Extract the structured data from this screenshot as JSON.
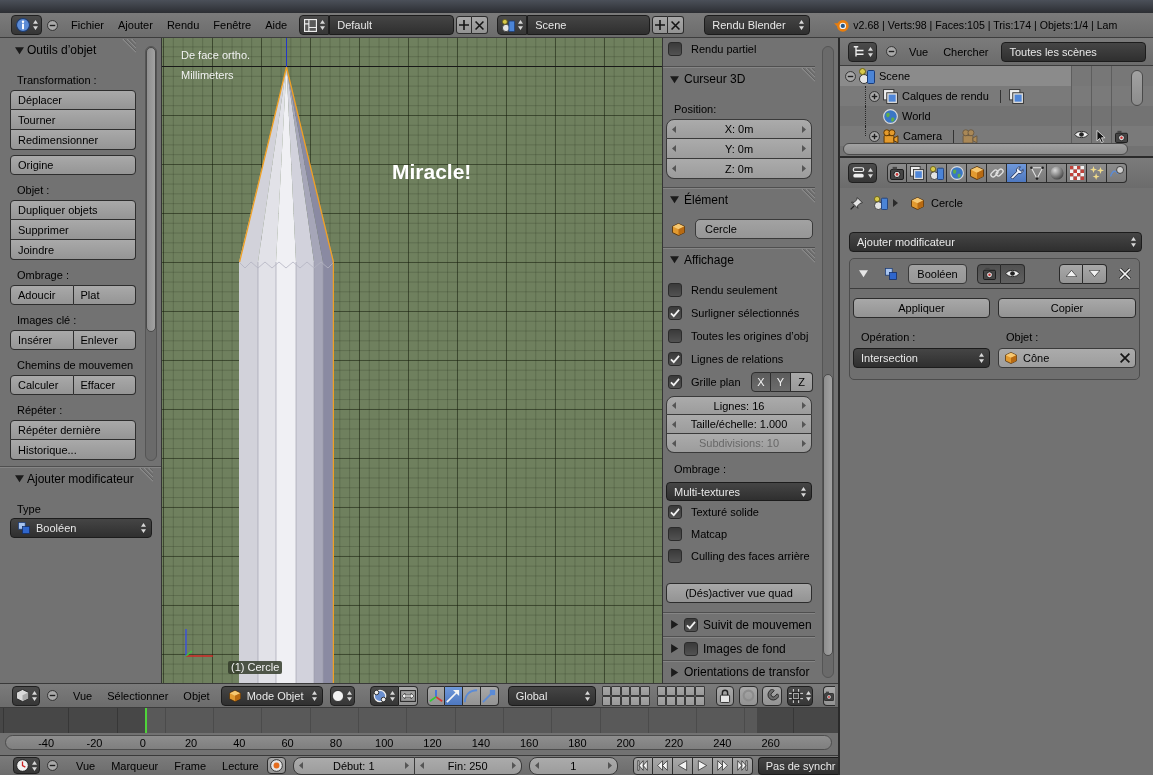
{
  "info_header": {
    "menus": [
      "Fichier",
      "Ajouter",
      "Rendu",
      "Fenêtre",
      "Aide"
    ],
    "screen_layout": "Default",
    "scene": "Scene",
    "render_engine": "Rendu Blender",
    "stats": "v2.68 | Verts:98 | Faces:105 | Tris:174 | Objets:1/4 | Lam"
  },
  "tool_shelf": {
    "object_tools": {
      "title": "Outils d’objet",
      "expanded": true,
      "groups": [
        {
          "label": "Transformation :",
          "kind": "column",
          "buttons": [
            "Déplacer",
            "Tourner",
            "Redimensionner"
          ]
        },
        {
          "kind": "column",
          "buttons": [
            "Origine"
          ]
        },
        {
          "label": "Objet :",
          "kind": "column",
          "buttons": [
            "Dupliquer objets",
            "Supprimer",
            "Joindre"
          ]
        },
        {
          "label": "Ombrage :",
          "kind": "row",
          "buttons": [
            "Adoucir",
            "Plat"
          ]
        },
        {
          "label": "Images clé :",
          "kind": "row",
          "buttons": [
            "Insérer",
            "Enlever"
          ]
        },
        {
          "label": "Chemins de mouvemen",
          "kind": "row",
          "buttons": [
            "Calculer",
            "Effacer"
          ]
        },
        {
          "label": "Répéter :",
          "kind": "column",
          "buttons": [
            "Répéter dernière",
            "Historique..."
          ]
        }
      ]
    },
    "add_modifier": {
      "title": "Ajouter modificateur",
      "expanded": true,
      "type_label": "Type",
      "type_value": "Booléen"
    }
  },
  "viewport": {
    "view_name": "De face ortho.",
    "units": "Millimeters",
    "annotation": "Miracle!",
    "object_label": "(1) Cercle"
  },
  "view_panel": {
    "partial_render": {
      "label": "Rendu partiel",
      "checked": false
    },
    "cursor": {
      "title": "Curseur 3D",
      "expanded": true,
      "position_label": "Position:",
      "fields": [
        "X: 0m",
        "Y: 0m",
        "Z: 0m"
      ]
    },
    "item": {
      "title": "Élément",
      "expanded": true,
      "name": "Cercle"
    },
    "display": {
      "title": "Affichage",
      "expanded": true,
      "options": [
        {
          "label": "Rendu seulement",
          "checked": false
        },
        {
          "label": "Surligner sélectionnés",
          "checked": true
        },
        {
          "label": "Toutes les origines d’obj",
          "checked": false
        },
        {
          "label": "Lignes de relations",
          "checked": true
        }
      ],
      "grid_floor": {
        "label": "Grille plan",
        "checked": true,
        "axes": [
          {
            "label": "X",
            "on": true
          },
          {
            "label": "Y",
            "on": true
          },
          {
            "label": "Z",
            "on": false
          }
        ]
      },
      "grid_fields": [
        {
          "label": "Lignes: 16",
          "disabled": false
        },
        {
          "label": "Taille/échelle: 1.000",
          "disabled": false
        },
        {
          "label": "Subdivisions: 10",
          "disabled": true
        }
      ],
      "shading_label": "Ombrage :",
      "shading_mode": "Multi-textures",
      "shading_options": [
        {
          "label": "Texturé solide",
          "checked": true
        },
        {
          "label": "Matcap",
          "checked": false
        },
        {
          "label": "Culling des faces arrière",
          "checked": false
        }
      ],
      "quad_view_button": "(Dés)activer vue quad"
    },
    "collapsed_panels": [
      {
        "title": "Suivit de mouvemen",
        "expanded": false,
        "kind": "checkbox",
        "checked": true
      },
      {
        "title": "Images de fond",
        "expanded": false,
        "kind": "checkbox",
        "checked": false
      },
      {
        "title": "Orientations de transfor",
        "expanded": false,
        "kind": "plain"
      }
    ]
  },
  "outliner": {
    "menus": [
      "Vue",
      "Chercher"
    ],
    "filter": "Toutes les scènes",
    "tree": [
      {
        "label": "Scene",
        "kind": "scene",
        "expanded": true,
        "selected": true,
        "children": [
          {
            "label": "Calques de rendu",
            "kind": "render_layers",
            "expanded": false,
            "selected": false
          },
          {
            "label": "World",
            "kind": "world",
            "selected": false
          },
          {
            "label": "Camera",
            "kind": "camera",
            "expanded": false,
            "selected": false
          }
        ]
      }
    ]
  },
  "properties": {
    "tabs": [
      {
        "kind": "render",
        "selected": false
      },
      {
        "kind": "render_layers",
        "selected": false
      },
      {
        "kind": "scene",
        "selected": false
      },
      {
        "kind": "world",
        "selected": false
      },
      {
        "kind": "object",
        "selected": false
      },
      {
        "kind": "constraints",
        "selected": false
      },
      {
        "kind": "modifiers",
        "selected": true
      },
      {
        "kind": "data",
        "selected": false
      },
      {
        "kind": "material",
        "selected": false
      },
      {
        "kind": "texture",
        "selected": false
      },
      {
        "kind": "particles",
        "selected": false
      },
      {
        "kind": "physics",
        "selected": false
      }
    ],
    "context": "Cercle",
    "add_modifier": "Ajouter modificateur",
    "modifier": {
      "name": "Booléen",
      "expanded": true,
      "apply_button": "Appliquer",
      "copy_button": "Copier",
      "operation_label": "Opération :",
      "operation": "Intersection",
      "object_label": "Objet :",
      "object": "Cône"
    }
  },
  "view3d_header": {
    "menus": [
      "Vue",
      "Sélectionner",
      "Objet"
    ],
    "mode": "Mode Objet",
    "manipulators": [
      {
        "kind": "axes",
        "selected": false
      },
      {
        "kind": "translate",
        "selected": true
      },
      {
        "kind": "rotate",
        "selected": false
      },
      {
        "kind": "scale",
        "selected": false
      }
    ],
    "orientation": "Global"
  },
  "timeline": {
    "ruler": [
      "-40",
      "-20",
      "0",
      "20",
      "40",
      "60",
      "80",
      "100",
      "120",
      "140",
      "160",
      "180",
      "200",
      "220",
      "240",
      "260"
    ],
    "menus": [
      "Vue",
      "Marqueur",
      "Frame",
      "Lecture"
    ],
    "start": "Début: 1",
    "end": "Fin: 250",
    "current_frame": "1",
    "sync": "Pas de synchr"
  }
}
